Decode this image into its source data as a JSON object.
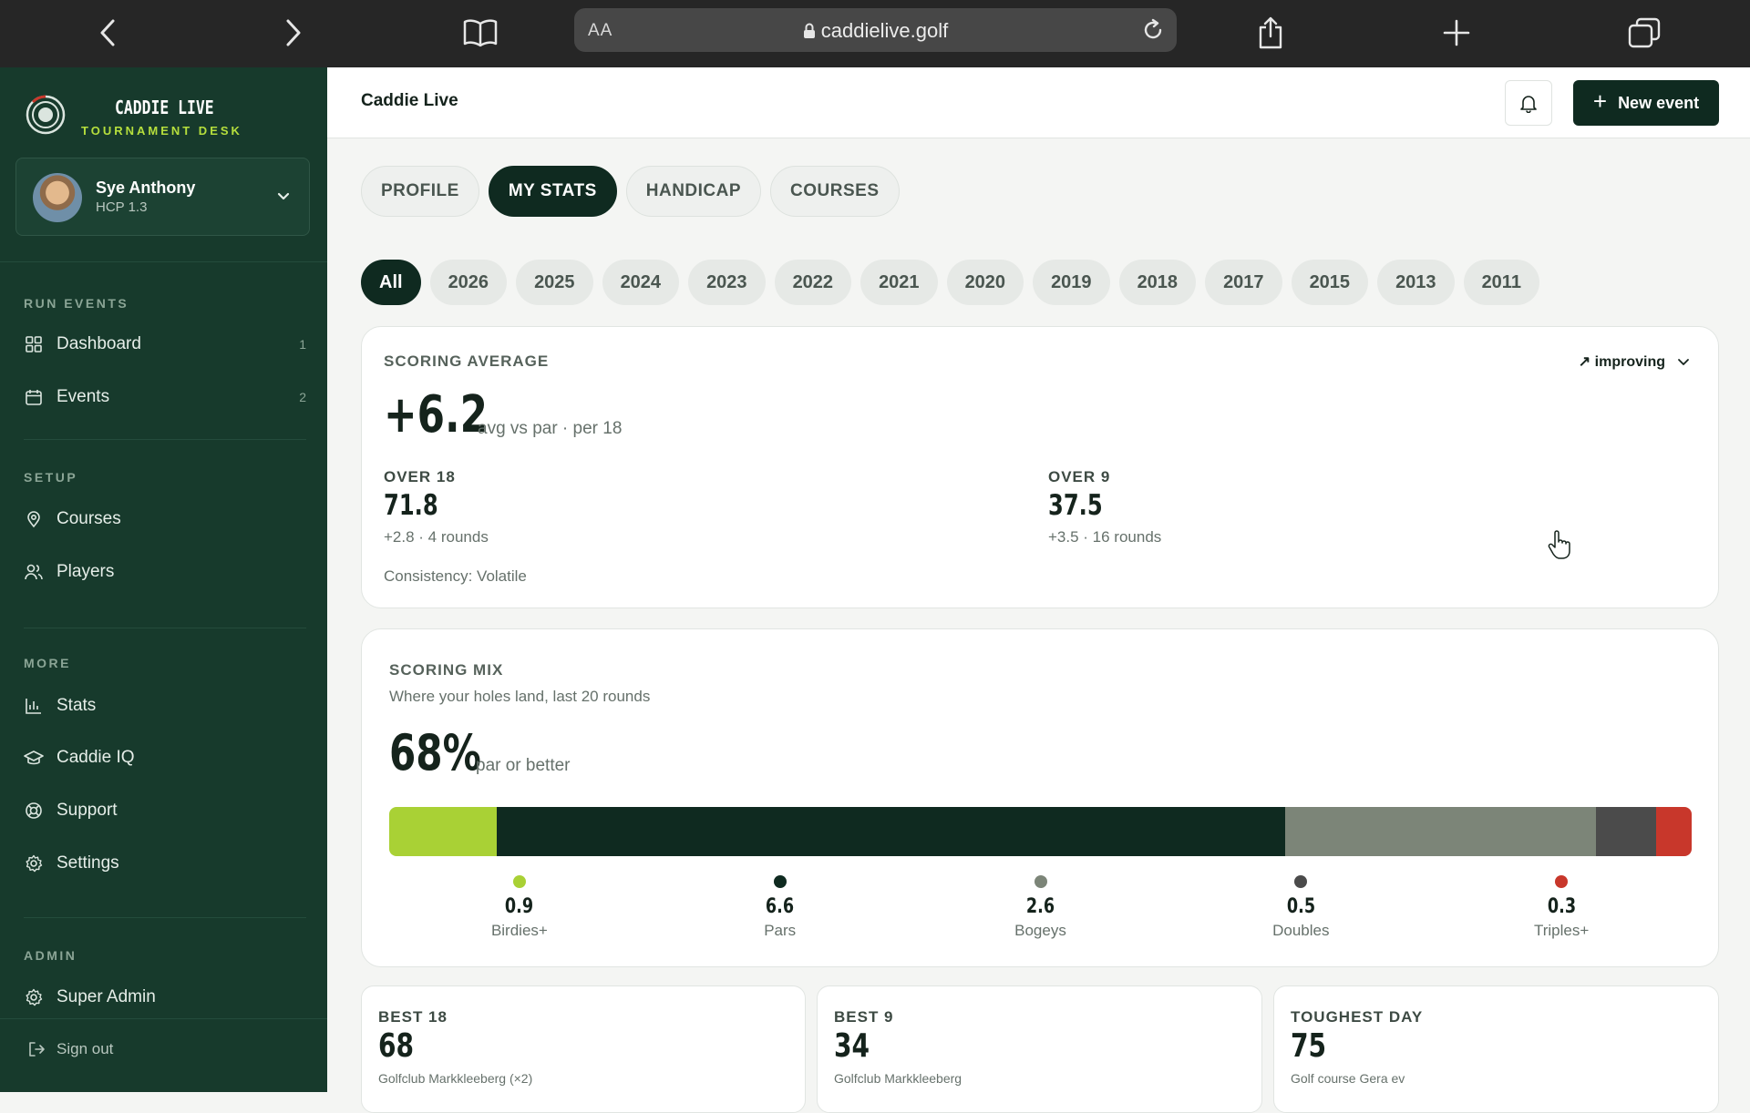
{
  "browser": {
    "text_size_label": "AA",
    "url": "caddielive.golf"
  },
  "sidebar": {
    "brand_title": "CADDIE LIVE",
    "brand_subtitle": "TOURNAMENT DESK",
    "user": {
      "name": "Sye Anthony",
      "hcp": "HCP 1.3"
    },
    "sections": {
      "run_events": "RUN EVENTS",
      "setup": "SETUP",
      "more": "MORE",
      "admin": "ADMIN"
    },
    "items": {
      "dashboard": {
        "label": "Dashboard",
        "count": "1",
        "icon": "grid-icon"
      },
      "events": {
        "label": "Events",
        "count": "2",
        "icon": "calendar-icon"
      },
      "courses": {
        "label": "Courses",
        "icon": "map-pin-icon"
      },
      "players": {
        "label": "Players",
        "icon": "users-icon"
      },
      "stats": {
        "label": "Stats",
        "icon": "bar-chart-icon"
      },
      "caddie_iq": {
        "label": "Caddie IQ",
        "icon": "graduation-cap-icon"
      },
      "support": {
        "label": "Support",
        "icon": "lifebuoy-icon"
      },
      "settings": {
        "label": "Settings",
        "icon": "gear-icon"
      },
      "super_admin": {
        "label": "Super Admin",
        "icon": "gear-icon"
      }
    },
    "sign_out": "Sign out"
  },
  "header": {
    "title": "Caddie Live",
    "new_event_label": "New event"
  },
  "tabs": [
    "PROFILE",
    "MY STATS",
    "HANDICAP",
    "COURSES"
  ],
  "active_tab": "MY STATS",
  "years": [
    "All",
    "2026",
    "2025",
    "2024",
    "2023",
    "2022",
    "2021",
    "2020",
    "2019",
    "2018",
    "2017",
    "2015",
    "2013",
    "2011"
  ],
  "active_year": "All",
  "scoring_average": {
    "label": "SCORING AVERAGE",
    "trend": "improving",
    "value": "+6.2",
    "value_caption": "avg vs par · per 18",
    "over18": {
      "label": "OVER 18",
      "value": "71.8",
      "detail": "+2.8 · 4 rounds"
    },
    "over9": {
      "label": "OVER 9",
      "value": "37.5",
      "detail": "+3.5 · 16 rounds"
    },
    "consistency": "Consistency: Volatile"
  },
  "scoring_mix": {
    "label": "SCORING MIX",
    "subtitle": "Where your holes land, last 20 rounds",
    "value": "68%",
    "value_caption": "par or better",
    "segments": [
      {
        "name": "Birdies+",
        "value": "0.9",
        "color": "#a9d135"
      },
      {
        "name": "Pars",
        "value": "6.6",
        "color": "#0f2a20"
      },
      {
        "name": "Bogeys",
        "value": "2.6",
        "color": "#7c8578"
      },
      {
        "name": "Doubles",
        "value": "0.5",
        "color": "#4b4b4b"
      },
      {
        "name": "Triples+",
        "value": "0.3",
        "color": "#c8372b"
      }
    ]
  },
  "summary_cards": {
    "best18": {
      "label": "BEST 18",
      "value": "68",
      "course": "Golfclub Markkleeberg (×2)"
    },
    "best9": {
      "label": "BEST 9",
      "value": "34",
      "course": "Golfclub Markkleeberg"
    },
    "toughest": {
      "label": "TOUGHEST DAY",
      "value": "75",
      "course": "Golf course Gera ev"
    }
  },
  "colors": {
    "sidebar_bg": "#173a2c",
    "primary_dark": "#0f2a20",
    "accent_lime": "#a9d135"
  }
}
